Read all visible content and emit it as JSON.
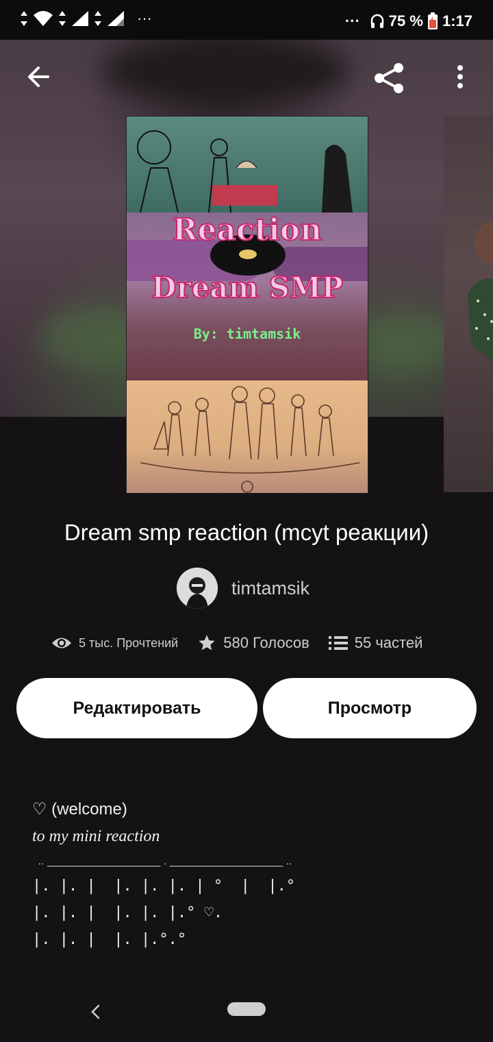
{
  "status_bar": {
    "dots_left": "···",
    "dots_right": "···",
    "battery": "75 %",
    "time": "1:17"
  },
  "cover": {
    "line1": "Reaction",
    "line2": "Dream SMP",
    "by": "By: timtamsik"
  },
  "story": {
    "title": "Dream smp reaction (mcyt реакции)",
    "author": "timtamsik",
    "reads": "5 тыс. Прочтений",
    "votes": "580 Голосов",
    "parts": "55 частей"
  },
  "buttons": {
    "edit": "Редактировать",
    "preview": "Просмотр"
  },
  "description": {
    "line1": "♡ (welcome)",
    "line2": "to my mini reaction",
    "line3": "  .. ____________________ . ____________________ ..",
    "line4": "|. |. |  |. |. |. | °  |  |.°",
    "line5": "|. |. |  |. |. |.° ♡.",
    "line6": "|. |. |  |. |.°.°"
  },
  "icons": {
    "back": "arrow-left-icon",
    "share": "share-icon",
    "more": "more-vert-icon",
    "views": "eye-icon",
    "votes": "star-icon",
    "parts": "list-icon",
    "nav_back": "chevron-left-icon",
    "nav_home": "home-pill-icon"
  },
  "colors": {
    "background": "#141214",
    "button_bg": "#ffffff",
    "cover_title_pink": "#c7266f",
    "cover_by_green": "#79f08a"
  }
}
